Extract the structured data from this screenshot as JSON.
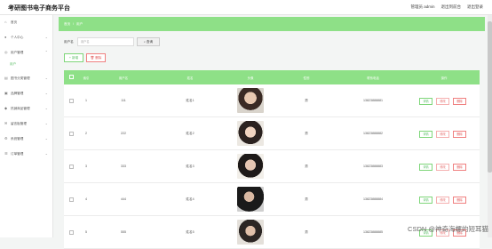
{
  "header": {
    "title": "考研图书电子商务平台",
    "user_label": "管理员 admin",
    "back_home": "退出到前台",
    "logout": "退出登录"
  },
  "sidebar": {
    "items": [
      {
        "label": "首页",
        "icon": "home-icon"
      },
      {
        "label": "个人中心",
        "icon": "user-icon"
      },
      {
        "label": "用户管理",
        "icon": "users-icon",
        "sub": "用户"
      },
      {
        "label": "图书分类管理",
        "icon": "category-icon"
      },
      {
        "label": "品牌管理",
        "icon": "brand-icon"
      },
      {
        "label": "热销商品管理",
        "icon": "hot-icon"
      },
      {
        "label": "留言板管理",
        "icon": "message-icon"
      },
      {
        "label": "系统管理",
        "icon": "settings-icon"
      },
      {
        "label": "订单管理",
        "icon": "order-icon"
      }
    ]
  },
  "breadcrumb": {
    "home": "首页",
    "sep": "/",
    "current": "用户"
  },
  "search": {
    "label": "用户名",
    "placeholder": "用户名",
    "button": "查询"
  },
  "actions": {
    "add": "+ 新增",
    "delete": "删除"
  },
  "table": {
    "columns": [
      "",
      "索引",
      "用户名",
      "姓名",
      "头像",
      "性别",
      "联系电话",
      "操作"
    ],
    "rows": [
      {
        "index": "1",
        "username": "111",
        "name": "姓名1",
        "gender": "男",
        "phone": "13823888881"
      },
      {
        "index": "2",
        "username": "222",
        "name": "姓名2",
        "gender": "男",
        "phone": "13823888882"
      },
      {
        "index": "3",
        "username": "333",
        "name": "姓名3",
        "gender": "男",
        "phone": "13823888883"
      },
      {
        "index": "4",
        "username": "444",
        "name": "姓名4",
        "gender": "男",
        "phone": "13823888884"
      },
      {
        "index": "5",
        "username": "555",
        "name": "姓名5",
        "gender": "男",
        "phone": "13823888885"
      }
    ],
    "row_buttons": {
      "detail": "详情",
      "edit": "修改",
      "delete": "删除"
    }
  },
  "watermark": "CSDN @神奇海螺的短耳猫"
}
